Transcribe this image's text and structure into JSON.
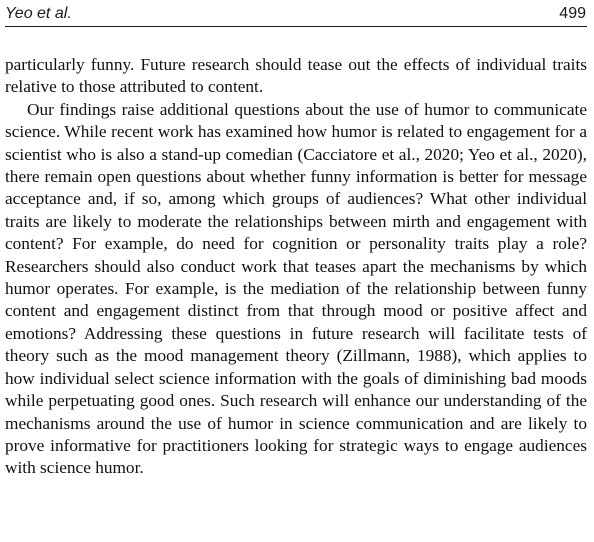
{
  "header": {
    "running_title": "Yeo et al.",
    "page_number": "499"
  },
  "paragraphs": [
    {
      "text": "particularly funny. Future research should tease out the effects of individual traits relative to those attributed to content."
    },
    {
      "text": "Our findings raise additional questions about the use of humor to communicate science. While recent work has examined how humor is related to engagement for a scientist who is also a stand-up comedian (Cacciatore et al., 2020; Yeo et al., 2020), there remain open questions about whether funny information is better for message acceptance and, if so, among which groups of audiences? What other individual traits are likely to moderate the relationships between mirth and engagement with content? For example, do need for cognition or personality traits play a role? Researchers should also conduct work that teases apart the mechanisms by which humor operates. For example, is the mediation of the relationship between funny content and engagement distinct from that through mood or positive affect and emotions? Addressing these questions in future research will facilitate tests of theory such as the mood management theory (Zillmann, 1988), which applies to how individual select science information with the goals of diminishing bad moods while perpetuating good ones. Such research will enhance our understanding of the mechanisms around the use of humor in science communication and are likely to prove informative for practitioners looking for strategic ways to engage audiences with science humor."
    }
  ]
}
